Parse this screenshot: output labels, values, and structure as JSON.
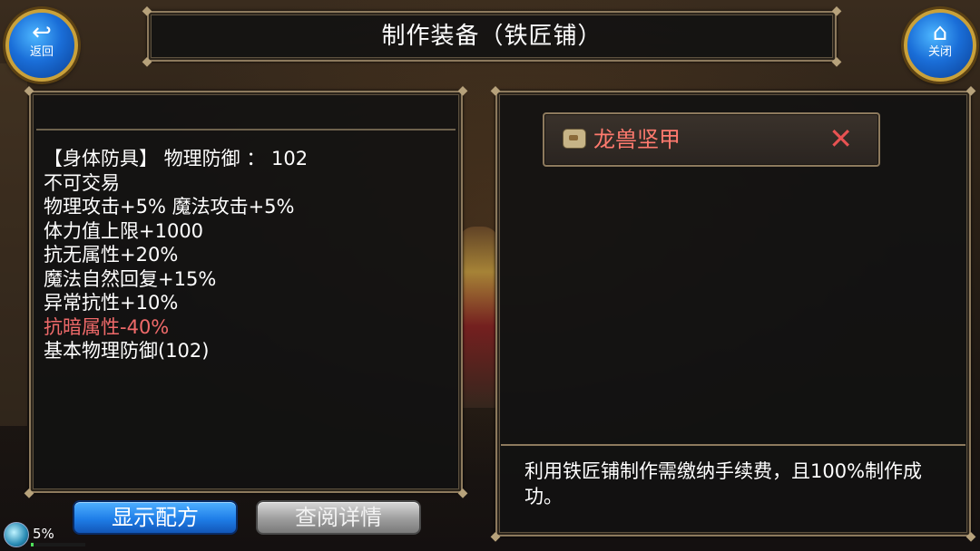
{
  "header": {
    "title": "制作装备（铁匠铺）"
  },
  "nav": {
    "back_label": "返回",
    "close_label": "关闭",
    "back_icon": "back-arrow-icon",
    "close_icon": "home-icon"
  },
  "item_stats": {
    "lines": [
      {
        "text": "【身体防具】 物理防御 ：  102",
        "negative": false
      },
      {
        "text": "不可交易",
        "negative": false
      },
      {
        "text": "物理攻击+5% 魔法攻击+5%",
        "negative": false
      },
      {
        "text": "体力值上限+1000",
        "negative": false
      },
      {
        "text": "抗无属性+20%",
        "negative": false
      },
      {
        "text": "魔法自然回复+15%",
        "negative": false
      },
      {
        "text": "异常抗性+10%",
        "negative": false
      },
      {
        "text": "抗暗属性-40%",
        "negative": true
      },
      {
        "text": "基本物理防御(102)",
        "negative": false
      }
    ],
    "negative_color": "#f06a6a"
  },
  "material_slot": {
    "item_name": "龙兽坚甲",
    "icon": "scroll-icon",
    "remove_icon": "close-icon"
  },
  "info": {
    "text": "利用铁匠铺制作需缴纳手续费，且100%制作成功。"
  },
  "buttons": {
    "show_recipe": "显示配方",
    "view_details": "查阅详情"
  },
  "status": {
    "percent_label": "5%",
    "percent": 5,
    "bar_color": "#4fe05a"
  }
}
